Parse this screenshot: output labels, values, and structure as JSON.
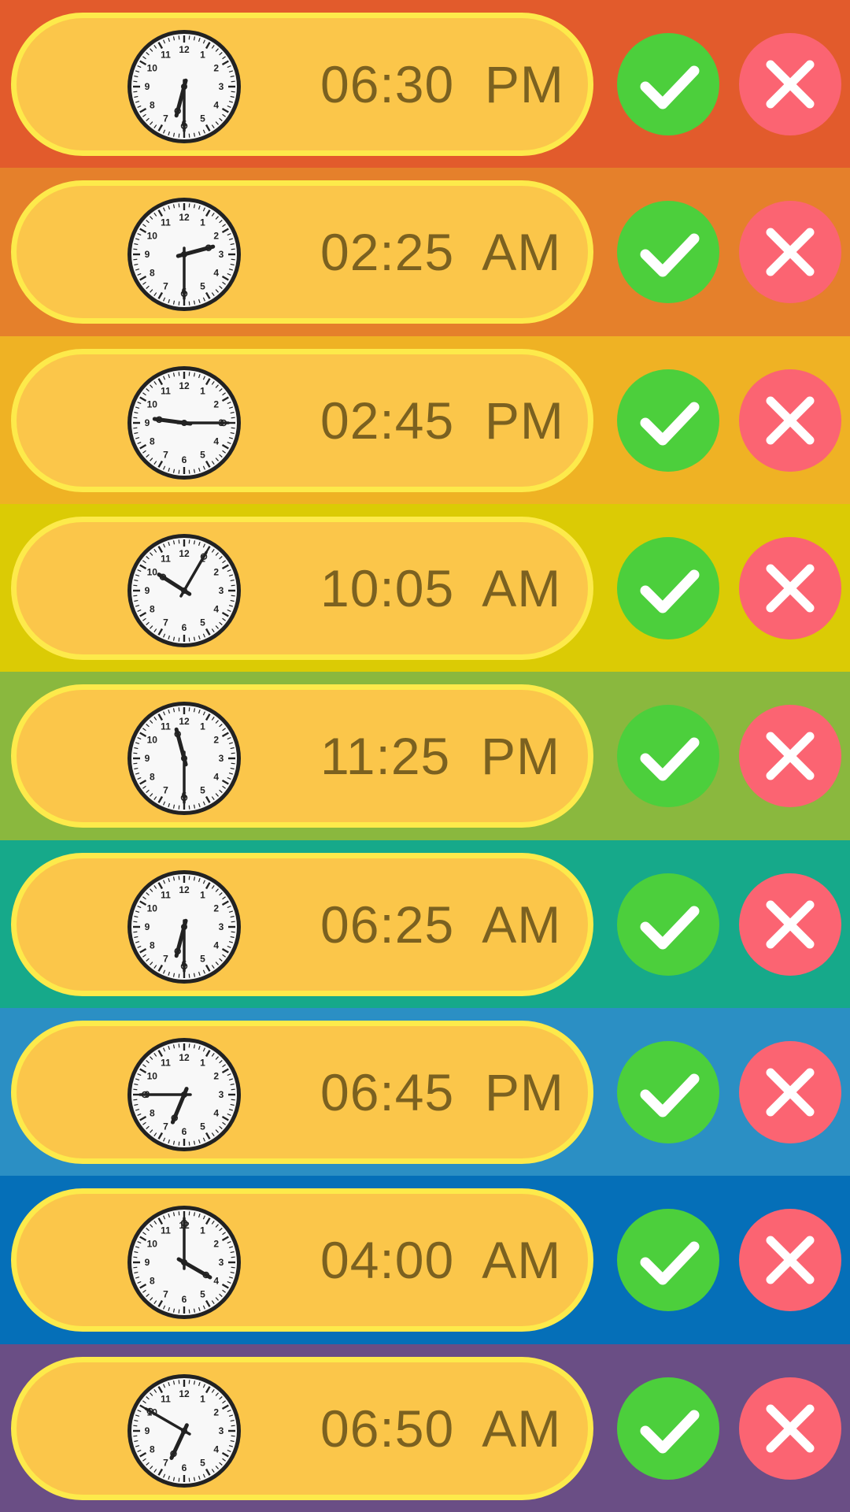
{
  "colors": {
    "pill_fill": "#fbc64a",
    "pill_border": "#fdea4b",
    "time_text": "#7b6120",
    "accept": "#4ccf3c",
    "reject": "#fb6472"
  },
  "alarms": [
    {
      "time": "06:30",
      "period": "PM",
      "clock_hour": 6,
      "clock_minute": 30,
      "row_color": "#e25b2c"
    },
    {
      "time": "02:25",
      "period": "AM",
      "clock_hour": 2,
      "clock_minute": 30,
      "row_color": "#e5802b"
    },
    {
      "time": "02:45",
      "period": "PM",
      "clock_hour": 9,
      "clock_minute": 15,
      "row_color": "#efb224"
    },
    {
      "time": "10:05",
      "period": "AM",
      "clock_hour": 10,
      "clock_minute": 5,
      "row_color": "#dbcb05"
    },
    {
      "time": "11:25",
      "period": "PM",
      "clock_hour": 11,
      "clock_minute": 30,
      "row_color": "#8ab83e"
    },
    {
      "time": "06:25",
      "period": "AM",
      "clock_hour": 6,
      "clock_minute": 30,
      "row_color": "#16a98a"
    },
    {
      "time": "06:45",
      "period": "PM",
      "clock_hour": 6,
      "clock_minute": 45,
      "row_color": "#2b8fc4"
    },
    {
      "time": "04:00",
      "period": "AM",
      "clock_hour": 4,
      "clock_minute": 0,
      "row_color": "#056fb8"
    },
    {
      "time": "06:50",
      "period": "AM",
      "clock_hour": 6,
      "clock_minute": 50,
      "row_color": "#6a4e85"
    }
  ],
  "icons": {
    "accept": "checkmark-icon",
    "reject": "x-icon"
  }
}
